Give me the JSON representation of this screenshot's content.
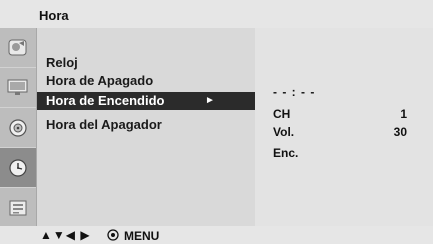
{
  "header": {
    "title": "Hora"
  },
  "icons": [
    "picture-icon",
    "screen-icon",
    "audio-icon",
    "clock-icon",
    "setup-icon"
  ],
  "menu": {
    "items": [
      {
        "label": "Reloj"
      },
      {
        "label": "Hora de Apagado"
      },
      {
        "label": "Hora de Encendido",
        "selected": true
      },
      {
        "label": "Hora del Apagador"
      }
    ],
    "selected_arrow": "►"
  },
  "info": {
    "time": "- - : - -",
    "rows": [
      {
        "label": "CH",
        "value": "1"
      },
      {
        "label": "Vol.",
        "value": "30"
      },
      {
        "label": "Enc.",
        "value": ""
      }
    ]
  },
  "footer": {
    "nav_arrows": "▲▼◀ ▶",
    "menu_label": "MENU"
  },
  "colors": {
    "highlight_bg": "#2b2b2b",
    "highlight_fg": "#ffffff",
    "panel_bg": "#d9d9d9"
  }
}
